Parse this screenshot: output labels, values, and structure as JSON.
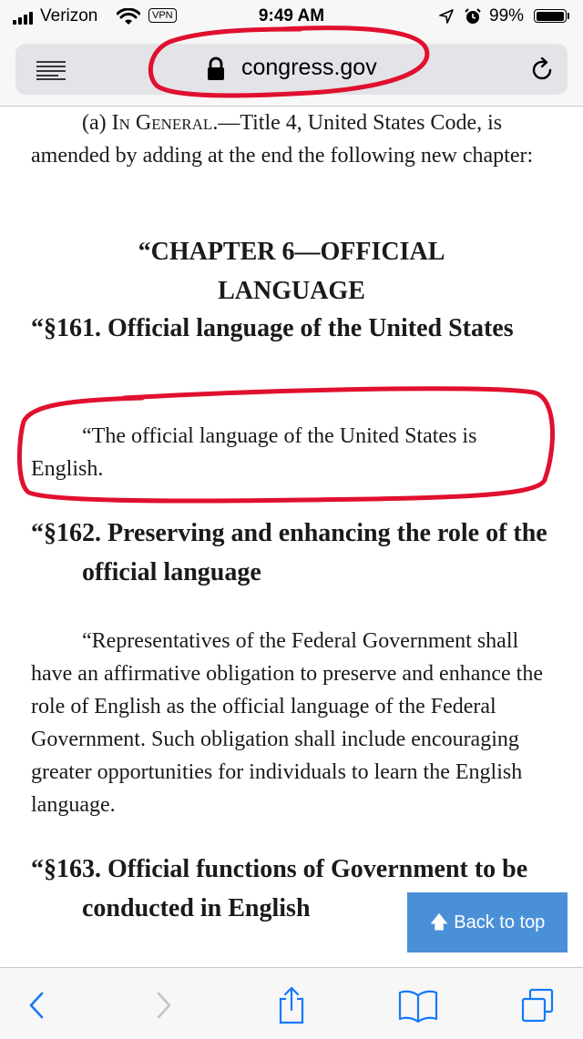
{
  "status_bar": {
    "carrier": "Verizon",
    "vpn_badge": "VPN",
    "time": "9:49 AM",
    "battery_percent": "99%",
    "battery_level": 0.99
  },
  "address_bar": {
    "url": "congress.gov"
  },
  "document": {
    "intro_label": "(a) I",
    "intro_label_sc": "n",
    "intro_general_G": " G",
    "intro_general_sc": "eneral",
    "intro_rest": ".—Title 4, United States Code, is amended by adding at the end the following new chapter:",
    "chapter_heading": "“CHAPTER 6—OFFICIAL LANGUAGE",
    "sections": [
      {
        "heading": "“§161. Official language of the United States",
        "body": "“The official language of the United States is English."
      },
      {
        "heading": "“§162. Preserving and enhancing the role of the official language",
        "body": "“Representatives of the Federal Government shall have an affirmative obligation to preserve and enhance the role of English as the official language of the Federal Government. Such obligation shall include encouraging greater opportunities for individuals to learn the English language."
      },
      {
        "heading": "“§163. Official functions of Government to be conducted in English",
        "body": ""
      }
    ]
  },
  "back_to_top": {
    "label": "Back to top"
  },
  "colors": {
    "annotation": "#e0102e",
    "button": "#4a90d9",
    "ios_blue": "#1479fb"
  }
}
